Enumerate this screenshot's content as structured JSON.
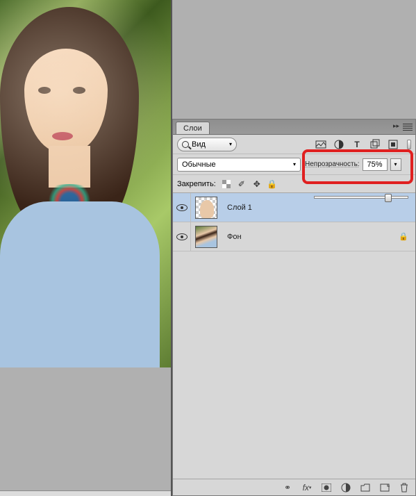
{
  "panel": {
    "tab_label": "Слои",
    "filter": {
      "label": "Вид"
    },
    "blend_mode": "Обычные",
    "opacity": {
      "label": "Непрозрачность:",
      "value": "75%",
      "percent": 75
    },
    "lock": {
      "label": "Закрепить:"
    },
    "layers": [
      {
        "name": "Слой 1",
        "selected": true,
        "visible": true,
        "locked": false,
        "thumb": "checker"
      },
      {
        "name": "Фон",
        "selected": false,
        "visible": true,
        "locked": true,
        "thumb": "photo"
      }
    ]
  }
}
